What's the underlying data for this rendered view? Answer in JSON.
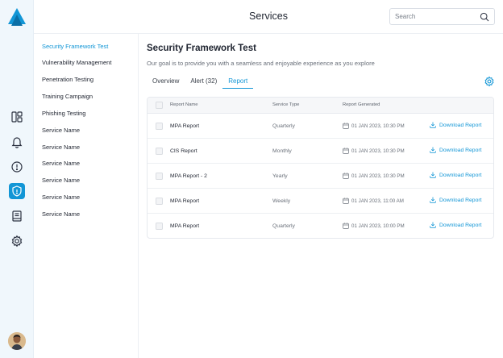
{
  "colors": {
    "accent": "#1296d6",
    "rail_bg": "#f0f7fc"
  },
  "rail": {
    "icons": [
      "dashboard-icon",
      "bell-icon",
      "alert-circle-icon",
      "shield-icon",
      "book-icon",
      "gear-icon"
    ],
    "active": "shield-icon"
  },
  "header": {
    "title": "Services",
    "search_placeholder": "Search"
  },
  "subnav": {
    "items": [
      "Security Framework Test",
      "Vulnerability Management",
      "Penetration Testing",
      "Training Campaign",
      "Phishing Testing",
      "Service Name",
      "Service Name",
      "Service Name",
      "Service Name",
      "Service Name",
      "Service Name"
    ],
    "active_index": 0
  },
  "main": {
    "title": "Security Framework Test",
    "subtitle": "Our goal is to provide you with a seamless and enjoyable experience as you explore",
    "tabs": [
      "Overview",
      "Alert (32)",
      "Report"
    ],
    "active_tab": "Report"
  },
  "table": {
    "columns": [
      "Report Name",
      "Service Type",
      "Report Generated"
    ],
    "download_label": "Download Report",
    "rows": [
      {
        "name": "MPA Report",
        "type": "Quarterly",
        "date": "01 JAN 2023, 10:30 PM"
      },
      {
        "name": "CIS Report",
        "type": "Monthly",
        "date": "01 JAN 2023, 10:30 PM"
      },
      {
        "name": "MPA Report - 2",
        "type": "Yearly",
        "date": "01 JAN 2023, 10:30 PM"
      },
      {
        "name": "MPA Report",
        "type": "Weekly",
        "date": "01 JAN 2023, 11:00 AM"
      },
      {
        "name": "MPA Report",
        "type": "Quarterly",
        "date": "01 JAN 2023, 10:00 PM"
      }
    ]
  }
}
